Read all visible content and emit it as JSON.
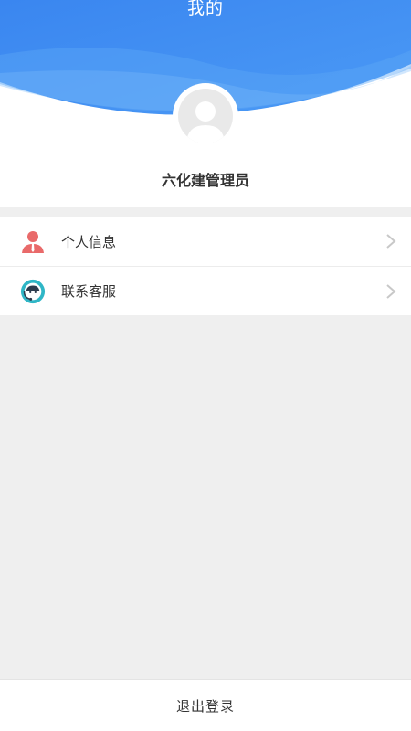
{
  "header": {
    "title": "我的",
    "accent_color": "#3d8cf2",
    "avatar_icon": "default-user-avatar-icon"
  },
  "profile": {
    "name": "六化建管理员"
  },
  "menu": {
    "items": [
      {
        "label": "个人信息",
        "icon": "user-profile-icon",
        "icon_color": "#e96a6a"
      },
      {
        "label": "联系客服",
        "icon": "customer-service-icon",
        "icon_color": "#2fb6c6"
      }
    ],
    "arrow_icon": "chevron-right-icon"
  },
  "footer": {
    "logout_label": "退出登录"
  }
}
